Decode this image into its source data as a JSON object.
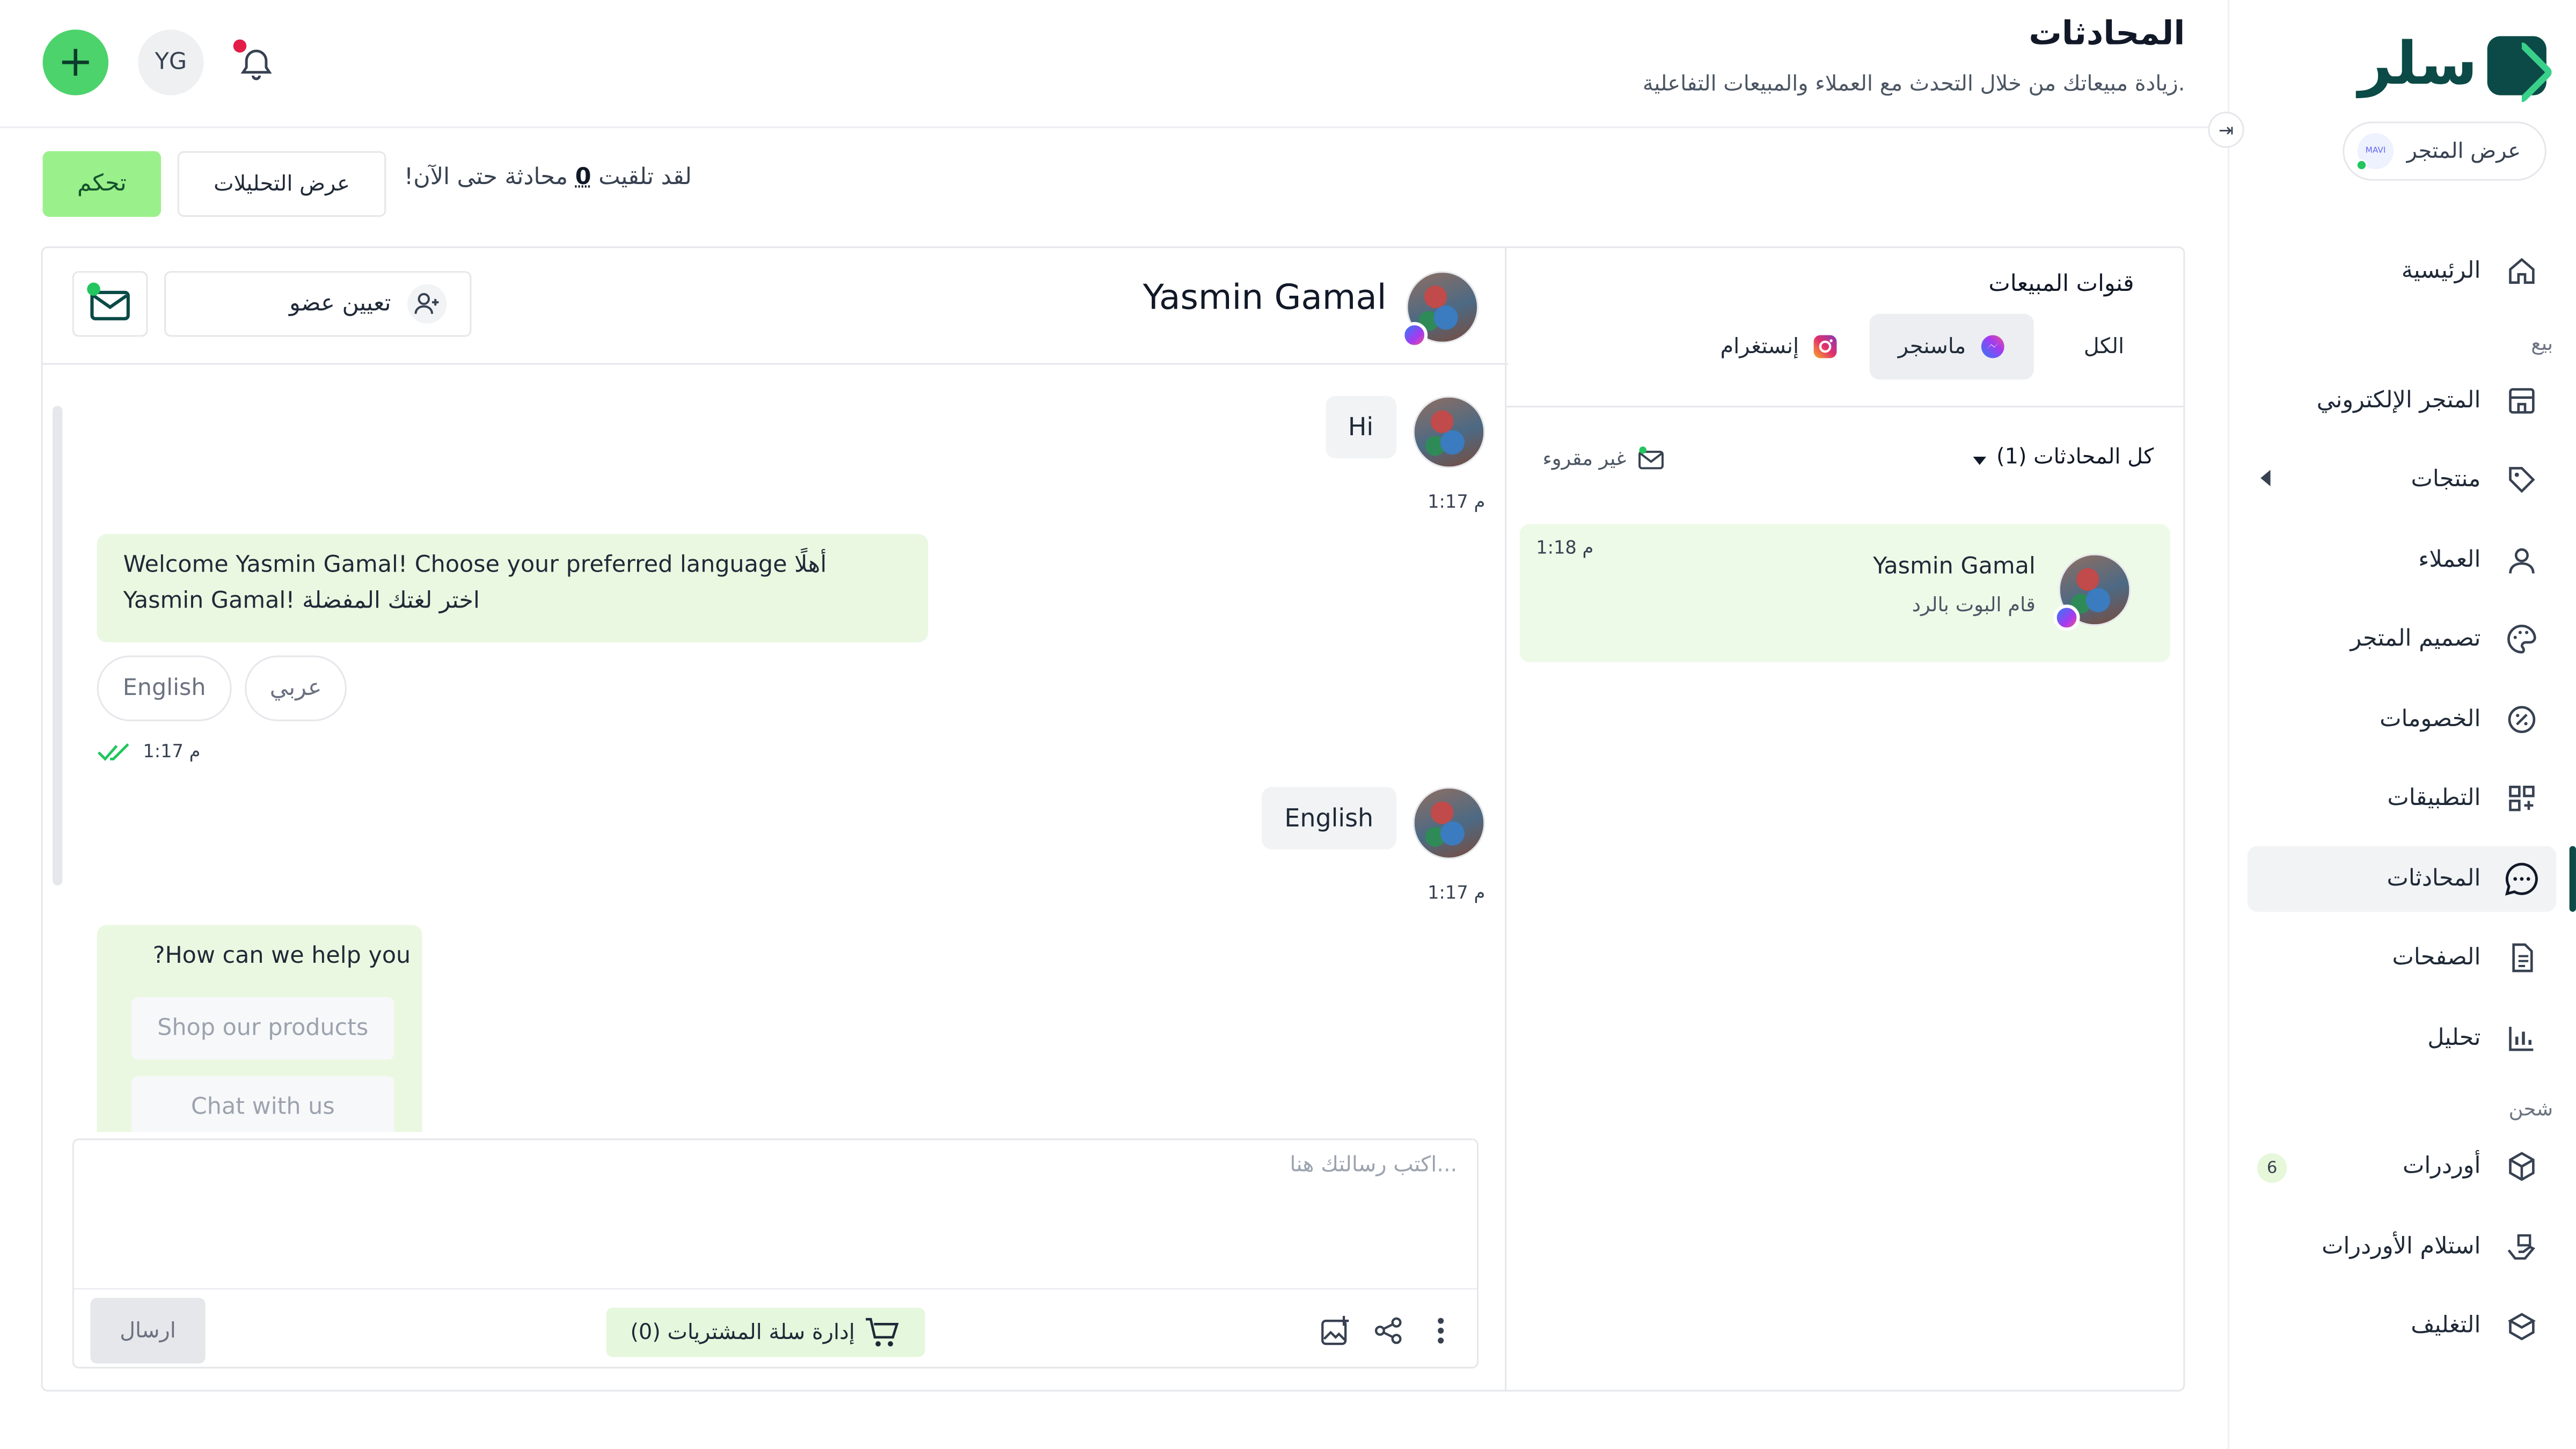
{
  "header": {
    "title": "المحادثات",
    "subtitle": "زيادة مبيعاتك من خلال التحدث مع العملاء والمبيعات التفاعلية.",
    "user_initials": "YG",
    "add_icon": "plus-icon",
    "notification_icon": "bell-icon"
  },
  "sidebar": {
    "logo_text": "سلر",
    "store_button": "عرض المتجر",
    "store_avatar_text": "MAVI",
    "items": [
      {
        "label": "الرئيسية",
        "icon": "home-icon"
      },
      {
        "section": "بيع"
      },
      {
        "label": "المتجر الإلكتروني",
        "icon": "storefront-icon"
      },
      {
        "label": "منتجات",
        "icon": "tag-icon"
      },
      {
        "label": "العملاء",
        "icon": "user-icon"
      },
      {
        "label": "تصميم المتجر",
        "icon": "palette-icon"
      },
      {
        "label": "الخصومات",
        "icon": "discount-icon"
      },
      {
        "label": "التطبيقات",
        "icon": "apps-icon"
      },
      {
        "label": "المحادثات",
        "icon": "chat-icon",
        "active": true
      },
      {
        "label": "الصفحات",
        "icon": "document-icon"
      },
      {
        "label": "تحليل",
        "icon": "bar-chart-icon"
      },
      {
        "section": "شحن"
      },
      {
        "label": "أوردرات",
        "icon": "box-icon",
        "badge": "6"
      },
      {
        "label": "استلام الأوردرات",
        "icon": "handover-icon"
      },
      {
        "label": "التغليف",
        "icon": "package-icon"
      }
    ]
  },
  "stats": {
    "text_prefix": "لقد تلقيت",
    "count": "0",
    "text_suffix": "محادثة حتى الآن!",
    "analytics_button": "عرض التحليلات",
    "control_button": "تحكم"
  },
  "channels": {
    "title": "قنوات المبيعات",
    "tabs": [
      {
        "label": "الكل"
      },
      {
        "label": "ماسنجر",
        "icon": "messenger-icon",
        "selected": true
      },
      {
        "label": "إنستغرام",
        "icon": "instagram-icon"
      }
    ],
    "filter_all": "كل المحادثات (1)",
    "filter_unread": "غير مقروء",
    "conversations": [
      {
        "name": "Yasmin Gamal",
        "preview": "قام البوت بالرد",
        "time": "1:18 م"
      }
    ]
  },
  "chat": {
    "contact_name": "Yasmin Gamal",
    "assign_button": "تعيين عضو",
    "messages": [
      {
        "direction": "in",
        "text": "Hi",
        "time": "1:17 م"
      },
      {
        "direction": "out",
        "text_line1": "Welcome Yasmin Gamal! Choose your preferred language أهلًا",
        "text_line2": "Yasmin Gamal! اختر لغتك المفضلة",
        "choices": [
          "English",
          "عربي"
        ],
        "time": "1:17 م"
      },
      {
        "direction": "in",
        "text": "English",
        "time": "1:17 م"
      },
      {
        "direction": "out",
        "text": "?How can we help you",
        "buttons": [
          "Shop our products",
          "Chat with us"
        ]
      }
    ],
    "composer_placeholder": "اكتب رسالتك هنا...",
    "cart_button": "إدارة سلة المشتريات (0)",
    "send_button": "ارسال"
  },
  "colors": {
    "brand_dark": "#0b4a46",
    "brand_green": "#4cd36b",
    "control_bg": "#9af08a",
    "outgoing_bubble": "#eaf8e1"
  }
}
